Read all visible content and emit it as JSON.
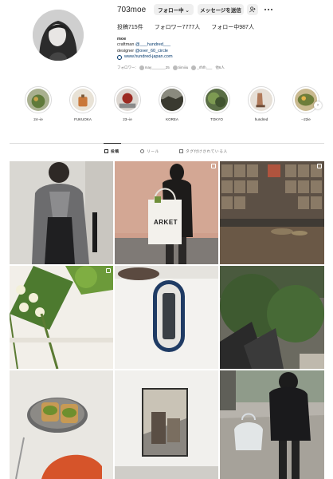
{
  "profile": {
    "username": "703moe",
    "following_button": "フォロー中 ⌄",
    "message_button": "メッセージを送信",
    "add_user_button": "+⁠ʀ",
    "stats": {
      "posts": "投稿715件",
      "followers": "フォロワー7777人",
      "following": "フォロー中987人"
    },
    "bio": {
      "name": "moe",
      "line1_prefix": "craftman ",
      "line1_mention": "@___hundred___",
      "line2_prefix": "designer ",
      "line2_mention": "@over_60_circle",
      "website": "www.hundred-japan.com"
    },
    "followed_by": {
      "label": "フォロワー:",
      "names": [
        "may_______25",
        "tiimiiiu",
        "_rfhfh___",
        "他6人"
      ]
    }
  },
  "highlights": [
    {
      "label": "24--ie"
    },
    {
      "label": "FUKUOKA"
    },
    {
      "label": "23--ie"
    },
    {
      "label": "KOREA"
    },
    {
      "label": "TOKYO"
    },
    {
      "label": "hundred"
    },
    {
      "label": "--22ie"
    }
  ],
  "tabs": {
    "posts": "投稿",
    "reels": "リール",
    "tagged": "タグ付けされている人"
  },
  "posts": {
    "tote_bag_text": "ARKET"
  },
  "colors": {
    "link": "#00376b",
    "button_bg": "#efefef",
    "divider": "#dbdbdb"
  }
}
